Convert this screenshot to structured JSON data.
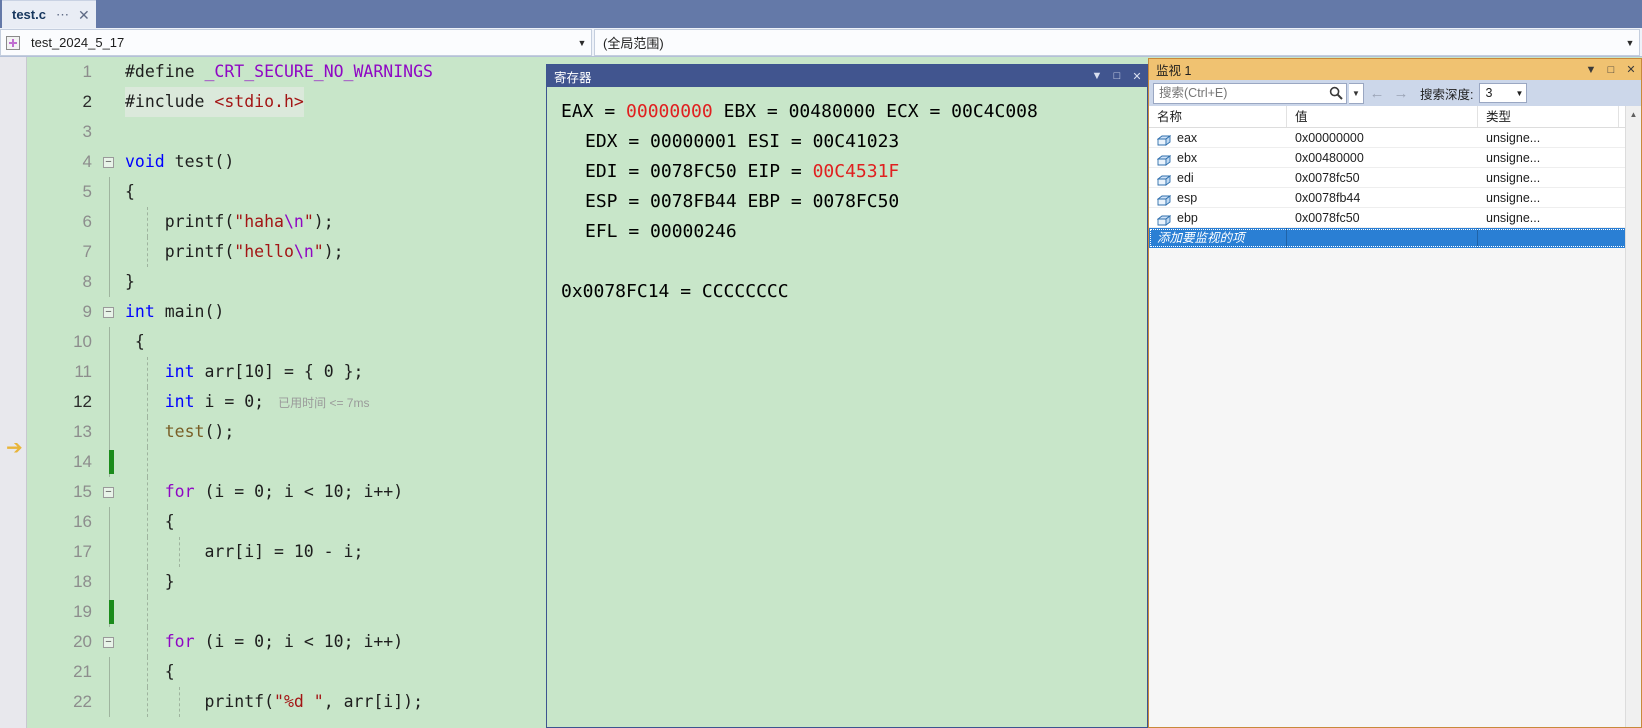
{
  "tab": {
    "title": "test.c",
    "pin_icon": "pin-icon",
    "close_icon": "close-icon"
  },
  "navbar": {
    "project_combo": "test_2024_5_17",
    "scope_combo": "(全局范围)",
    "project_icon": "add-item-icon"
  },
  "editor": {
    "background": "#c8e6c9",
    "exec_line": 12,
    "lines": [
      {
        "no": "1",
        "parts": [
          {
            "t": "#define ",
            "c": "pl"
          },
          {
            "t": "_CRT_SECURE_NO_WARNINGS",
            "c": "mac"
          }
        ]
      },
      {
        "no": "2",
        "parts": [
          {
            "t": "#include ",
            "c": "pl"
          },
          {
            "t": "<stdio.h>",
            "c": "inc"
          }
        ]
      },
      {
        "no": "3",
        "parts": []
      },
      {
        "no": "4",
        "parts": [
          {
            "t": "void ",
            "c": "k"
          },
          {
            "t": "test()",
            "c": "pl"
          }
        ]
      },
      {
        "no": "5",
        "parts": [
          {
            "t": "{",
            "c": "pl"
          }
        ]
      },
      {
        "no": "6",
        "parts": [
          {
            "t": "    ",
            "c": "pl"
          },
          {
            "t": "printf",
            "c": "pl"
          },
          {
            "t": "(",
            "c": "pl"
          },
          {
            "t": "\"haha",
            "c": "str"
          },
          {
            "t": "\\n",
            "c": "esc"
          },
          {
            "t": "\"",
            "c": "str"
          },
          {
            "t": ");",
            "c": "pl"
          }
        ]
      },
      {
        "no": "7",
        "parts": [
          {
            "t": "    ",
            "c": "pl"
          },
          {
            "t": "printf",
            "c": "pl"
          },
          {
            "t": "(",
            "c": "pl"
          },
          {
            "t": "\"hello",
            "c": "str"
          },
          {
            "t": "\\n",
            "c": "esc"
          },
          {
            "t": "\"",
            "c": "str"
          },
          {
            "t": ");",
            "c": "pl"
          }
        ]
      },
      {
        "no": "8",
        "parts": [
          {
            "t": "}",
            "c": "pl"
          }
        ]
      },
      {
        "no": "9",
        "parts": [
          {
            "t": "int ",
            "c": "k"
          },
          {
            "t": "main()",
            "c": "pl"
          }
        ]
      },
      {
        "no": "10",
        "parts": [
          {
            "t": " {",
            "c": "pl"
          }
        ]
      },
      {
        "no": "11",
        "parts": [
          {
            "t": "    ",
            "c": "pl"
          },
          {
            "t": "int ",
            "c": "k"
          },
          {
            "t": "arr[10] = { 0 };",
            "c": "pl"
          }
        ]
      },
      {
        "no": "12",
        "parts": [
          {
            "t": "    ",
            "c": "pl"
          },
          {
            "t": "int ",
            "c": "k"
          },
          {
            "t": "i = 0;",
            "c": "pl"
          }
        ]
      },
      {
        "no": "13",
        "parts": [
          {
            "t": "    ",
            "c": "pl"
          },
          {
            "t": "test",
            "c": "fn"
          },
          {
            "t": "();",
            "c": "pl"
          }
        ]
      },
      {
        "no": "14",
        "parts": []
      },
      {
        "no": "15",
        "parts": [
          {
            "t": "    ",
            "c": "pl"
          },
          {
            "t": "for",
            "c": "kw"
          },
          {
            "t": " (i = 0; i < 10; i++)",
            "c": "pl"
          }
        ]
      },
      {
        "no": "16",
        "parts": [
          {
            "t": "    {",
            "c": "pl"
          }
        ]
      },
      {
        "no": "17",
        "parts": [
          {
            "t": "        arr[i] = 10 - i;",
            "c": "pl"
          }
        ]
      },
      {
        "no": "18",
        "parts": [
          {
            "t": "    }",
            "c": "pl"
          }
        ]
      },
      {
        "no": "19",
        "parts": []
      },
      {
        "no": "20",
        "parts": [
          {
            "t": "    ",
            "c": "pl"
          },
          {
            "t": "for",
            "c": "kw"
          },
          {
            "t": " (i = 0; i < 10; i++)",
            "c": "pl"
          }
        ]
      },
      {
        "no": "21",
        "parts": [
          {
            "t": "    {",
            "c": "pl"
          }
        ]
      },
      {
        "no": "22",
        "parts": [
          {
            "t": "        ",
            "c": "pl"
          },
          {
            "t": "printf",
            "c": "pl"
          },
          {
            "t": "(",
            "c": "pl"
          },
          {
            "t": "\"%d \"",
            "c": "str"
          },
          {
            "t": ", arr[i]);",
            "c": "pl"
          }
        ]
      }
    ],
    "timing_annotation": "已用时间 <= 7ms",
    "exec_arrow_icon": "execution-pointer-icon"
  },
  "registers_window": {
    "title": "寄存器",
    "dropdown_icon": "chevron-down-icon",
    "maximize_icon": "maximize-icon",
    "close_icon": "close-icon",
    "lines": [
      {
        "indent": false,
        "segs": [
          {
            "t": "EAX = ",
            "red": false
          },
          {
            "t": "00000000",
            "red": true
          },
          {
            "t": " EBX = 00480000 ECX = 00C4C008",
            "red": false
          }
        ]
      },
      {
        "indent": true,
        "segs": [
          {
            "t": "EDX = 00000001 ESI = 00C41023",
            "red": false
          }
        ]
      },
      {
        "indent": true,
        "segs": [
          {
            "t": "EDI = 0078FC50 EIP = ",
            "red": false
          },
          {
            "t": "00C4531F",
            "red": true
          }
        ]
      },
      {
        "indent": true,
        "segs": [
          {
            "t": "ESP = 0078FB44 EBP = 0078FC50",
            "red": false
          }
        ]
      },
      {
        "indent": true,
        "segs": [
          {
            "t": "EFL = 00000246",
            "red": false
          }
        ]
      },
      {
        "indent": false,
        "segs": [
          {
            "t": "",
            "red": false
          }
        ]
      },
      {
        "indent": false,
        "segs": [
          {
            "t": "0x0078FC14 = CCCCCCCC",
            "red": false
          }
        ]
      }
    ]
  },
  "watch_window": {
    "title": "监视 1",
    "dropdown_icon": "chevron-down-icon",
    "maximize_icon": "maximize-icon",
    "close_icon": "close-icon",
    "search_placeholder": "搜索(Ctrl+E)",
    "search_value": "",
    "search_icon": "search-icon",
    "search_dropdown_icon": "chevron-down-icon",
    "back_icon": "arrow-left-icon",
    "forward_icon": "arrow-right-icon",
    "depth_label": "搜索深度:",
    "depth_value": "3",
    "depth_dropdown_icon": "chevron-down-icon",
    "columns": [
      "名称",
      "值",
      "类型"
    ],
    "rows": [
      {
        "name": "eax",
        "value": "0x00000000",
        "type": "unsigne...",
        "icon": "variable-box-icon"
      },
      {
        "name": "ebx",
        "value": "0x00480000",
        "type": "unsigne...",
        "icon": "variable-box-icon"
      },
      {
        "name": "edi",
        "value": "0x0078fc50",
        "type": "unsigne...",
        "icon": "variable-box-icon"
      },
      {
        "name": "esp",
        "value": "0x0078fb44",
        "type": "unsigne...",
        "icon": "variable-box-icon"
      },
      {
        "name": "ebp",
        "value": "0x0078fc50",
        "type": "unsigne...",
        "icon": "variable-box-icon"
      }
    ],
    "add_row_placeholder": "添加要监视的项",
    "scroll_up_icon": "scroll-up-icon",
    "selection_color": "#2a7fd4"
  }
}
